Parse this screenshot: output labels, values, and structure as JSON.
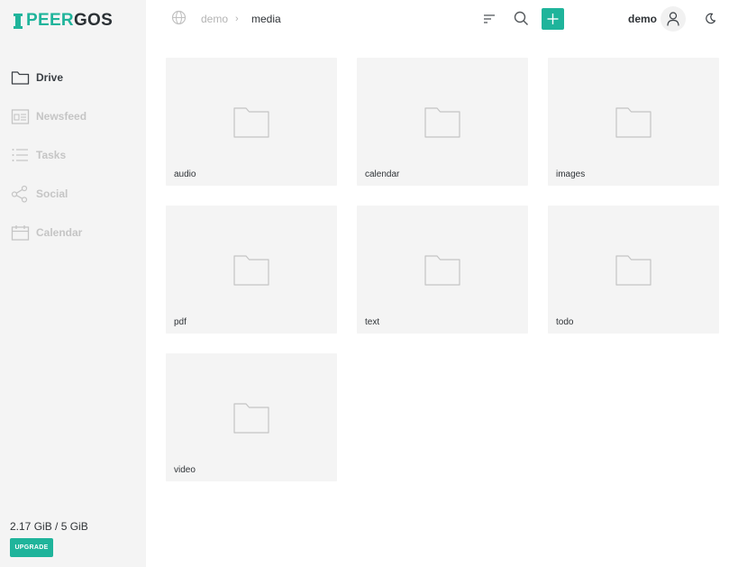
{
  "brand": {
    "logo_prefix": "PEER",
    "logo_suffix": "GOS",
    "accent_color": "#1fb49b"
  },
  "sidebar": {
    "items": [
      {
        "label": "Drive",
        "icon": "folder-icon",
        "active": true
      },
      {
        "label": "Newsfeed",
        "icon": "newsfeed-icon",
        "active": false
      },
      {
        "label": "Tasks",
        "icon": "tasks-list-icon",
        "active": false
      },
      {
        "label": "Social",
        "icon": "share-icon",
        "active": false
      },
      {
        "label": "Calendar",
        "icon": "calendar-icon",
        "active": false
      }
    ],
    "quota": "2.17 GiB / 5 GiB",
    "upgrade_label": "UPGRADE"
  },
  "header": {
    "breadcrumb": [
      "demo",
      "media"
    ],
    "breadcrumb_separator": "›",
    "username": "demo",
    "icons": [
      "globe-icon",
      "sort-icon",
      "search-icon",
      "plus-icon",
      "user-icon",
      "moon-icon"
    ]
  },
  "files": [
    {
      "name": "audio",
      "type": "folder"
    },
    {
      "name": "calendar",
      "type": "folder"
    },
    {
      "name": "images",
      "type": "folder"
    },
    {
      "name": "pdf",
      "type": "folder"
    },
    {
      "name": "text",
      "type": "folder"
    },
    {
      "name": "todo",
      "type": "folder"
    },
    {
      "name": "video",
      "type": "folder"
    }
  ]
}
